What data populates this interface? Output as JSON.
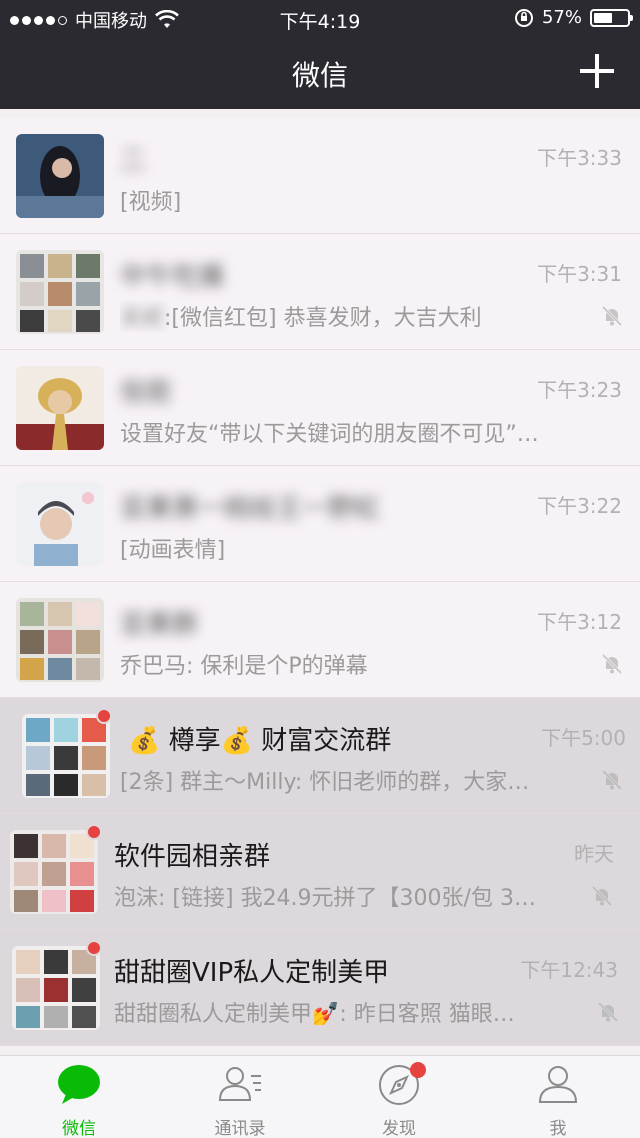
{
  "status_bar": {
    "carrier": "中国移动",
    "time": "下午4:19",
    "battery": "57%",
    "battery_level": 0.57
  },
  "nav": {
    "title": "微信"
  },
  "chats": [
    {
      "name": "二",
      "time": "下午3:33",
      "preview": "[视频]",
      "muted": false,
      "badge": false,
      "pinned": false
    },
    {
      "name": "中午吃播",
      "time": "下午3:31",
      "preview_sender": "吴妮",
      "preview": ":[微信红包] 恭喜发财，大吉大利",
      "muted": true,
      "badge": false,
      "pinned": false
    },
    {
      "name": "倪若",
      "time": "下午3:23",
      "preview": "设置好友“带以下关键词的朋友圈不可见”…",
      "muted": false,
      "badge": false,
      "pinned": false
    },
    {
      "name": "亚果萧一桃绘王一野虹",
      "time": "下午3:22",
      "preview": "[动画表情]",
      "muted": false,
      "badge": false,
      "pinned": false
    },
    {
      "name": "亚果群",
      "time": "下午3:12",
      "preview": "乔巴马: 保利是个P的弹幕",
      "muted": true,
      "badge": false,
      "pinned": false
    },
    {
      "name": "💰 樽享💰 财富交流群",
      "time": "下午5:00",
      "preview": "[2条] 群主～Milly: 怀旧老师的群，大家…",
      "muted": true,
      "badge": true,
      "pinned": true
    },
    {
      "name": "软件园相亲群",
      "time": "昨天",
      "preview": "泡沫: [链接] 我24.9元拼了【300张/包 3…",
      "muted": true,
      "badge": true,
      "pinned": true
    },
    {
      "name": "甜甜圈VIP私人定制美甲",
      "time": "下午12:43",
      "preview": "甜甜圈私人定制美甲💅: 昨日客照  猫眼…",
      "muted": true,
      "badge": true,
      "pinned": true
    }
  ],
  "tabs": [
    {
      "label": "微信",
      "active": true
    },
    {
      "label": "通讯录",
      "active": false
    },
    {
      "label": "发现",
      "active": false,
      "badge": true
    },
    {
      "label": "我",
      "active": false
    }
  ],
  "colors": {
    "accent": "#09bb07",
    "badge": "#e64340",
    "header": "#2b2a31"
  }
}
